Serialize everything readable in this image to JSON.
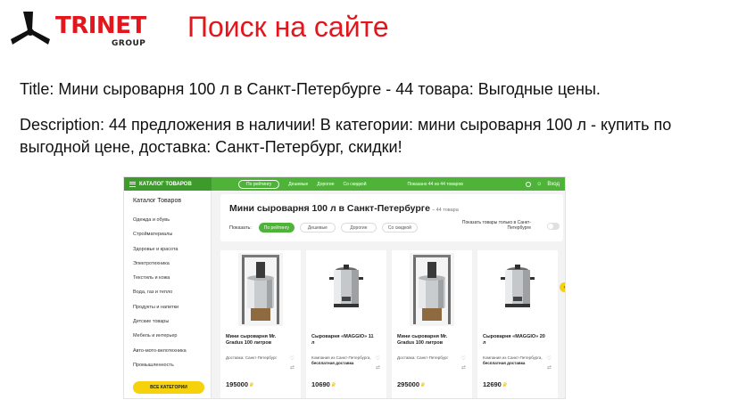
{
  "logo": {
    "word": "TRINET",
    "sub": "GROUP"
  },
  "slide_title": "Поиск на сайте",
  "title_line": "Title: Мини сыроварня 100 л в Санкт-Петербурге - 44 товара: Выгодные цены.",
  "description_line": "Description: 44 предложения в наличии! В категории: мини сыроварня 100 л - купить по выгодной цене, доставка: Санкт-Петербург, скидки!",
  "site": {
    "topbar": {
      "catalog_label": "КАТАЛОГ ТОВАРОВ",
      "sort_active": "По рейтингу",
      "links": [
        "Дешевые",
        "Дорогие",
        "Со скидкой"
      ],
      "count_text": "Показано 44 из 44 товаров",
      "login_label": "Вход"
    },
    "sidebar": {
      "title": "Каталог Товаров",
      "items": [
        "Одежда и обувь",
        "Стройматериалы",
        "Здоровье и красота",
        "Электротехника",
        "Текстиль и кожа",
        "Вода, газ и тепло",
        "Продукты и напитки",
        "Детские товары",
        "Мебель и интерьер",
        "Авто-мото-велотехника",
        "Промышленность"
      ],
      "all_button": "ВСЕ КАТЕГОРИИ"
    },
    "header": {
      "title": "Мини сыроварня 100 л в Санкт-Петербурге",
      "count": "– 44 товара",
      "show_label": "Показать:",
      "filters": [
        "По рейтингу",
        "Дешевые",
        "Дорогие",
        "Со скидкой"
      ],
      "spb_label": "Показать товары только в Санкт-Петербурге"
    },
    "products": [
      {
        "name": "Мини сыроварня Mr. Gradus 100 литров",
        "delivery": "Доставка: Санкт-Петербург",
        "delivery_extra": "",
        "price": "195000",
        "image": "cheese-vat-frame"
      },
      {
        "name": "Сыроварня «MAGGIO» 11 л",
        "delivery": "Компания из Санкт-Петербурга,",
        "delivery_extra": "бесплатная доставка",
        "price": "10690",
        "image": "cheese-pot"
      },
      {
        "name": "Мини сыроварня Mr. Gradus 100 литров",
        "delivery": "Доставка: Санкт-Петербург",
        "delivery_extra": "",
        "price": "295000",
        "image": "cheese-vat-frame"
      },
      {
        "name": "Сыроварня «MAGGIO» 20 л",
        "delivery": "Компания из Санкт-Петербурга,",
        "delivery_extra": "бесплатная доставка",
        "price": "12690",
        "image": "cheese-pot"
      }
    ],
    "currency_symbol": "₽",
    "colors": {
      "brand_red": "#e3161d",
      "green": "#4fb33a",
      "yellow": "#f5d20b"
    }
  }
}
